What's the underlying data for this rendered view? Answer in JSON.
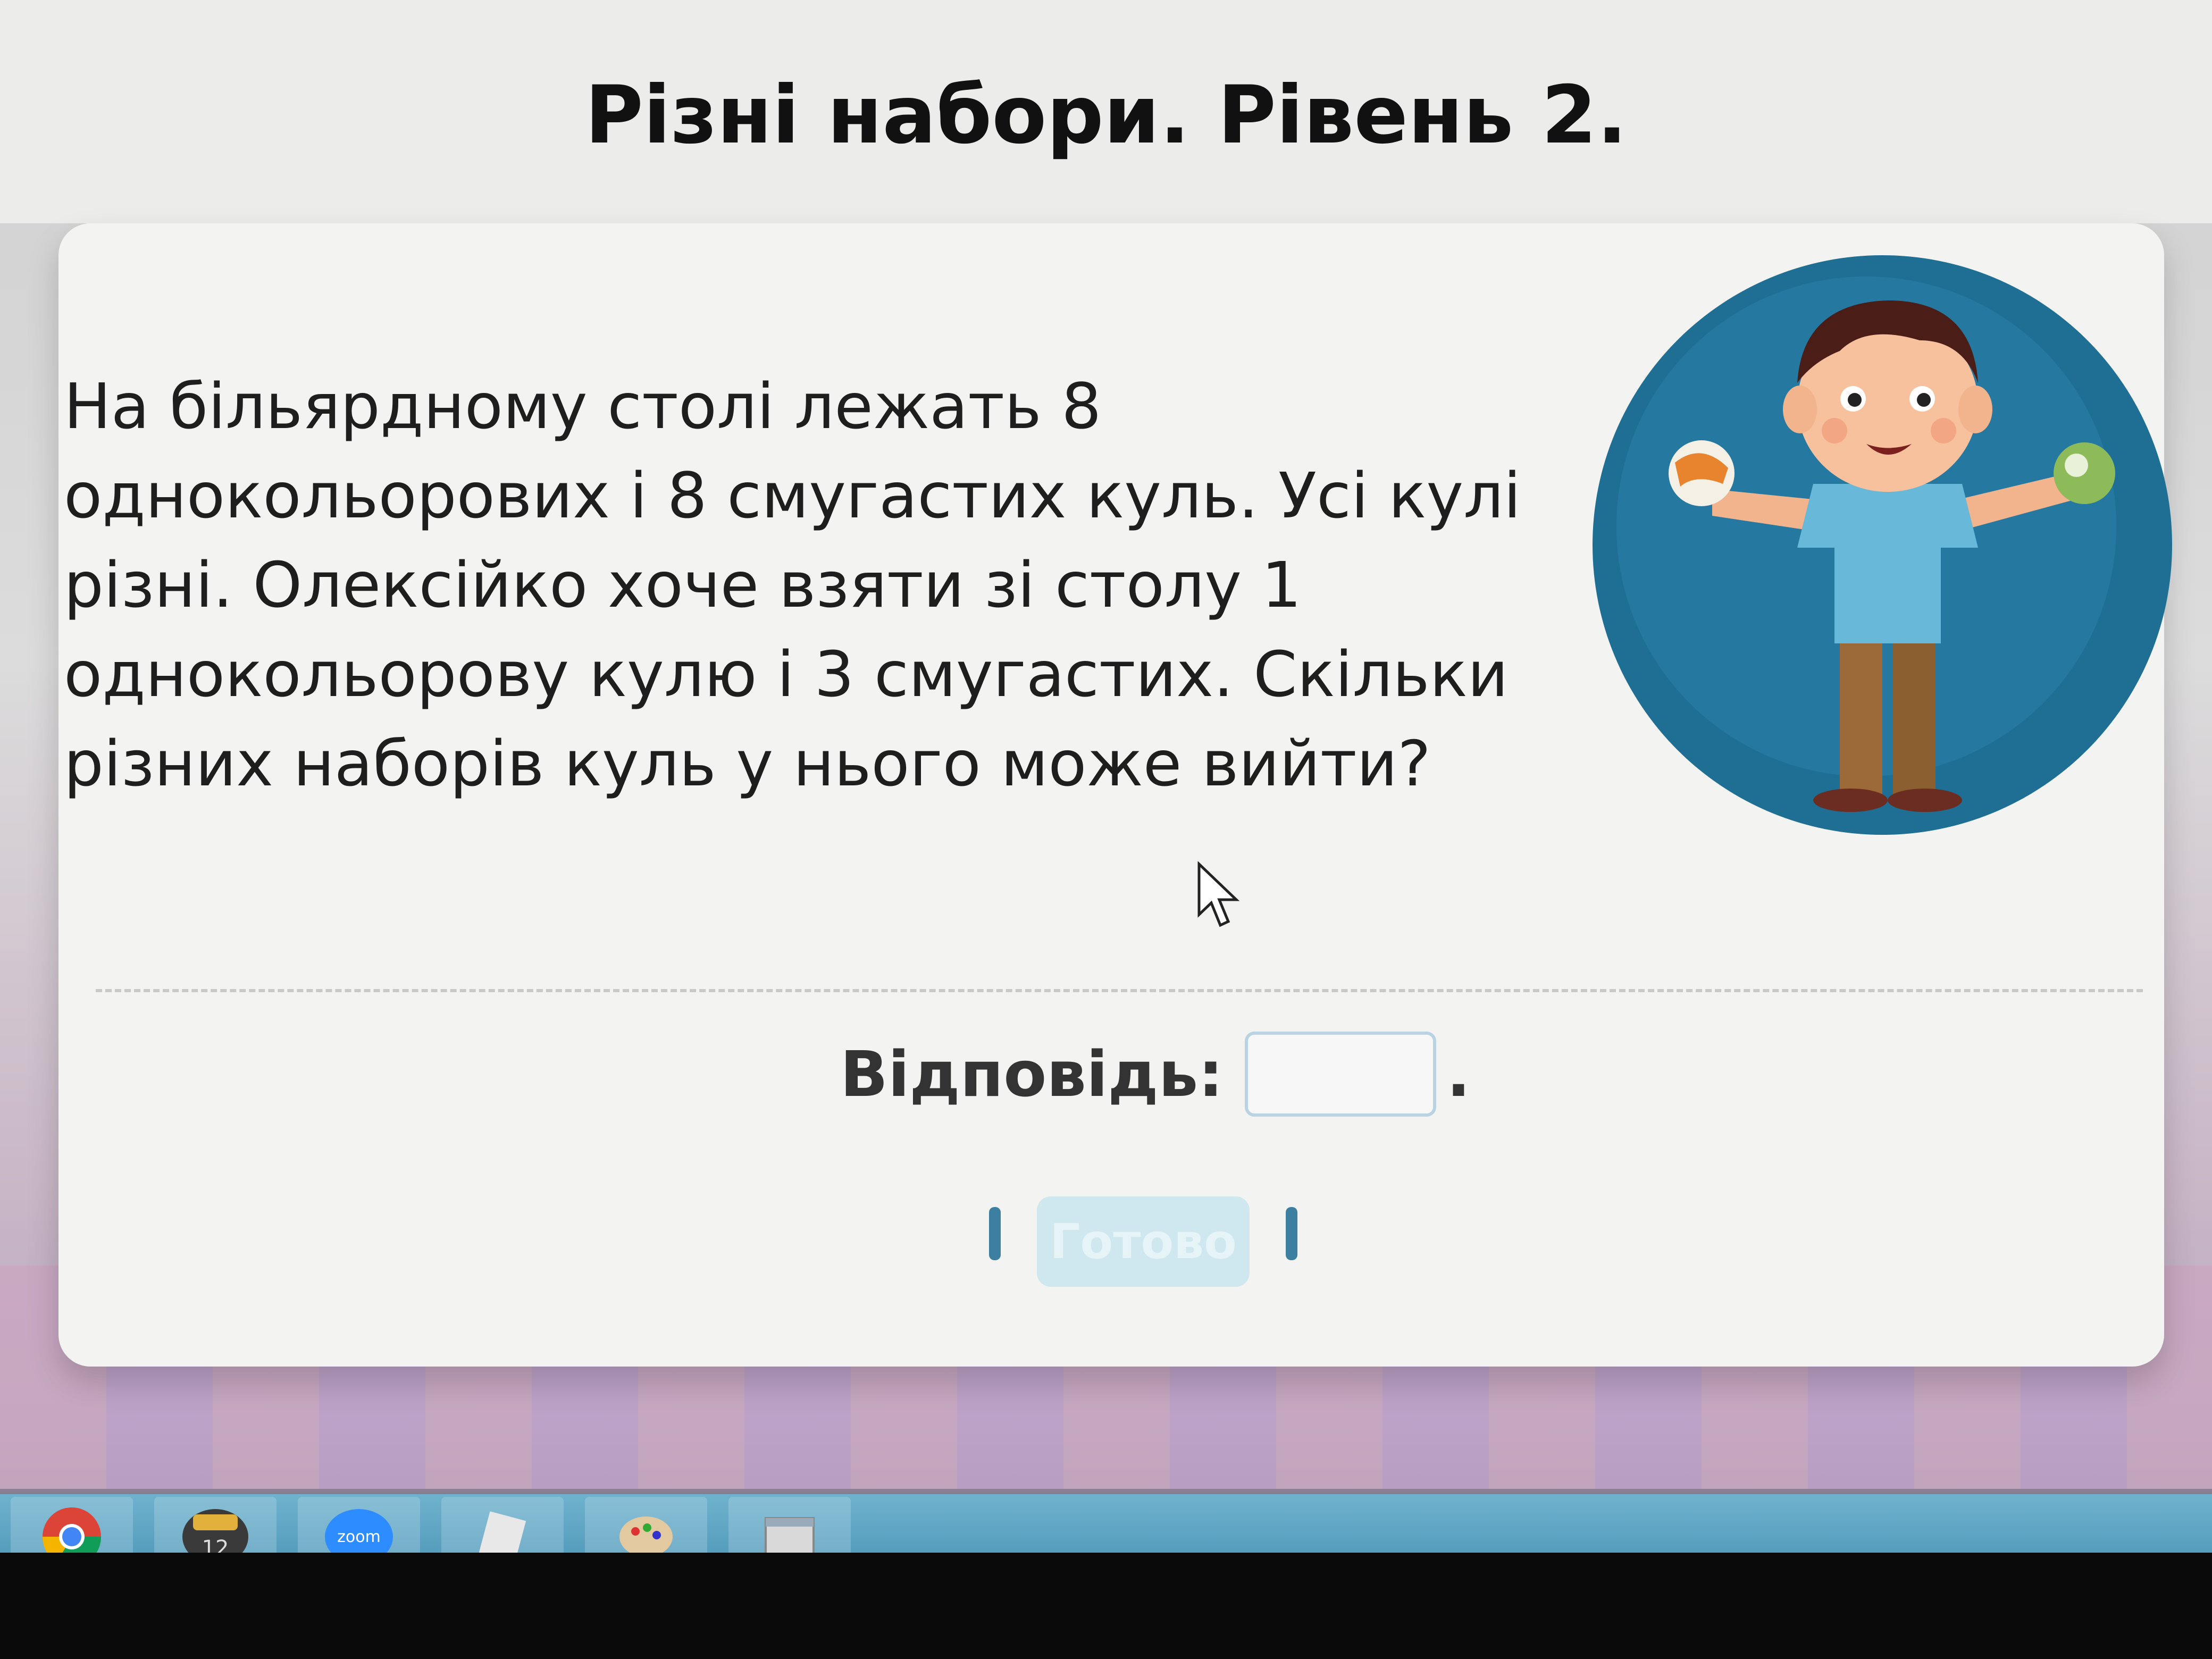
{
  "page": {
    "title": "Різні набори. Рівень 2."
  },
  "problem": {
    "lines": [
      "На більярдному столі лежать 8",
      "однокольорових і 8 смугастих куль. Усі кулі",
      "різні. Олексійко хоче взяти зі столу 1",
      "однокольорову кулю і 3 смугастих. Скільки",
      "різних наборів куль у нього може вийти?"
    ]
  },
  "answer": {
    "label": "Відповідь:",
    "value": "",
    "period": "."
  },
  "done_button": {
    "label": "Готово"
  },
  "taskbar": {
    "items": [
      {
        "name": "chrome-icon"
      },
      {
        "name": "calendar-icon",
        "text": "12"
      },
      {
        "name": "zoom-icon",
        "text": "zoom"
      },
      {
        "name": "notes-icon"
      },
      {
        "name": "paint-icon"
      },
      {
        "name": "window-icon"
      }
    ]
  },
  "colors": {
    "card_bg": "#f3f3f1",
    "circle_bg": "#1f6f95",
    "shirt": "#67b8d9",
    "pants": "#9b6a38",
    "button_bg": "#cfe7ee",
    "taskbar": "#4a94b6"
  }
}
